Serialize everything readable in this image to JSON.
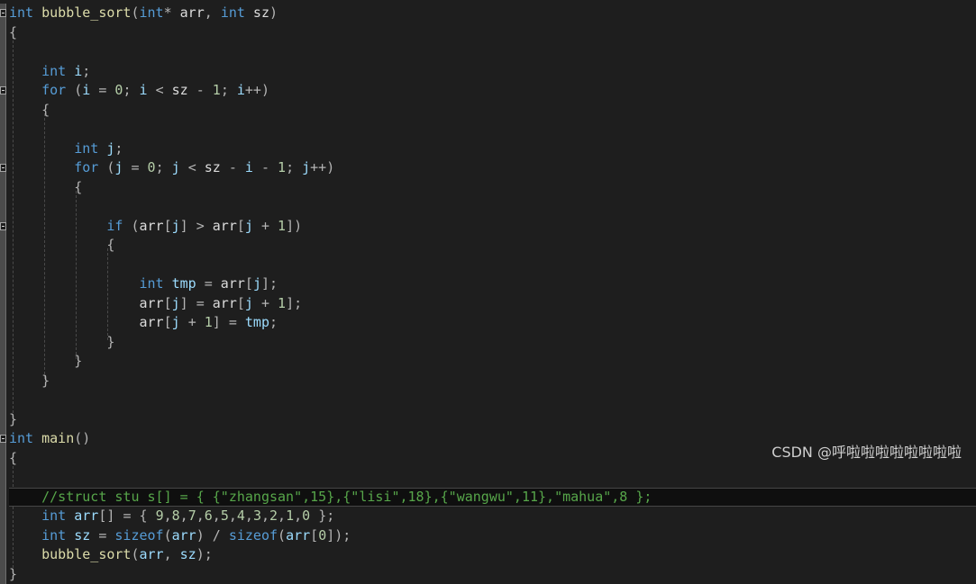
{
  "editor": {
    "lines": [
      [
        [
          "kw",
          "int"
        ],
        [
          "id",
          " "
        ],
        [
          "fn",
          "bubble_sort"
        ],
        [
          "op",
          "("
        ],
        [
          "kw",
          "int"
        ],
        [
          "op",
          "*"
        ],
        [
          "id",
          " arr"
        ],
        [
          "op",
          ","
        ],
        [
          "id",
          " "
        ],
        [
          "kw",
          "int"
        ],
        [
          "id",
          " sz"
        ],
        [
          "op",
          ")"
        ]
      ],
      [
        [
          "op",
          "{"
        ]
      ],
      [
        [
          "id",
          "    "
        ]
      ],
      [
        [
          "id",
          "    "
        ],
        [
          "kw",
          "int"
        ],
        [
          "id",
          " "
        ],
        [
          "var",
          "i"
        ],
        [
          "op",
          ";"
        ]
      ],
      [
        [
          "id",
          "    "
        ],
        [
          "kw",
          "for"
        ],
        [
          "id",
          " "
        ],
        [
          "op",
          "("
        ],
        [
          "var",
          "i"
        ],
        [
          "id",
          " "
        ],
        [
          "op",
          "="
        ],
        [
          "id",
          " "
        ],
        [
          "num",
          "0"
        ],
        [
          "op",
          ";"
        ],
        [
          "id",
          " "
        ],
        [
          "var",
          "i"
        ],
        [
          "id",
          " "
        ],
        [
          "op",
          "<"
        ],
        [
          "id",
          " sz "
        ],
        [
          "op",
          "-"
        ],
        [
          "id",
          " "
        ],
        [
          "num",
          "1"
        ],
        [
          "op",
          ";"
        ],
        [
          "id",
          " "
        ],
        [
          "var",
          "i"
        ],
        [
          "op",
          "++)"
        ]
      ],
      [
        [
          "id",
          "    "
        ],
        [
          "op",
          "{"
        ]
      ],
      [
        [
          "id",
          "        "
        ]
      ],
      [
        [
          "id",
          "        "
        ],
        [
          "kw",
          "int"
        ],
        [
          "id",
          " "
        ],
        [
          "var",
          "j"
        ],
        [
          "op",
          ";"
        ]
      ],
      [
        [
          "id",
          "        "
        ],
        [
          "kw",
          "for"
        ],
        [
          "id",
          " "
        ],
        [
          "op",
          "("
        ],
        [
          "var",
          "j"
        ],
        [
          "id",
          " "
        ],
        [
          "op",
          "="
        ],
        [
          "id",
          " "
        ],
        [
          "num",
          "0"
        ],
        [
          "op",
          ";"
        ],
        [
          "id",
          " "
        ],
        [
          "var",
          "j"
        ],
        [
          "id",
          " "
        ],
        [
          "op",
          "<"
        ],
        [
          "id",
          " sz "
        ],
        [
          "op",
          "-"
        ],
        [
          "id",
          " "
        ],
        [
          "var",
          "i"
        ],
        [
          "id",
          " "
        ],
        [
          "op",
          "-"
        ],
        [
          "id",
          " "
        ],
        [
          "num",
          "1"
        ],
        [
          "op",
          ";"
        ],
        [
          "id",
          " "
        ],
        [
          "var",
          "j"
        ],
        [
          "op",
          "++)"
        ]
      ],
      [
        [
          "id",
          "        "
        ],
        [
          "op",
          "{"
        ]
      ],
      [
        [
          "id",
          "            "
        ]
      ],
      [
        [
          "id",
          "            "
        ],
        [
          "kw",
          "if"
        ],
        [
          "id",
          " "
        ],
        [
          "op",
          "("
        ],
        [
          "id",
          "arr"
        ],
        [
          "op",
          "["
        ],
        [
          "var",
          "j"
        ],
        [
          "op",
          "]"
        ],
        [
          "id",
          " "
        ],
        [
          "op",
          ">"
        ],
        [
          "id",
          " arr"
        ],
        [
          "op",
          "["
        ],
        [
          "var",
          "j"
        ],
        [
          "id",
          " "
        ],
        [
          "op",
          "+"
        ],
        [
          "id",
          " "
        ],
        [
          "num",
          "1"
        ],
        [
          "op",
          "])"
        ]
      ],
      [
        [
          "id",
          "            "
        ],
        [
          "op",
          "{"
        ]
      ],
      [
        [
          "id",
          "                "
        ]
      ],
      [
        [
          "id",
          "                "
        ],
        [
          "kw",
          "int"
        ],
        [
          "id",
          " "
        ],
        [
          "var",
          "tmp"
        ],
        [
          "id",
          " "
        ],
        [
          "op",
          "="
        ],
        [
          "id",
          " arr"
        ],
        [
          "op",
          "["
        ],
        [
          "var",
          "j"
        ],
        [
          "op",
          "];"
        ]
      ],
      [
        [
          "id",
          "                arr"
        ],
        [
          "op",
          "["
        ],
        [
          "var",
          "j"
        ],
        [
          "op",
          "]"
        ],
        [
          "id",
          " "
        ],
        [
          "op",
          "="
        ],
        [
          "id",
          " arr"
        ],
        [
          "op",
          "["
        ],
        [
          "var",
          "j"
        ],
        [
          "id",
          " "
        ],
        [
          "op",
          "+"
        ],
        [
          "id",
          " "
        ],
        [
          "num",
          "1"
        ],
        [
          "op",
          "];"
        ]
      ],
      [
        [
          "id",
          "                arr"
        ],
        [
          "op",
          "["
        ],
        [
          "var",
          "j"
        ],
        [
          "id",
          " "
        ],
        [
          "op",
          "+"
        ],
        [
          "id",
          " "
        ],
        [
          "num",
          "1"
        ],
        [
          "op",
          "]"
        ],
        [
          "id",
          " "
        ],
        [
          "op",
          "="
        ],
        [
          "id",
          " "
        ],
        [
          "var",
          "tmp"
        ],
        [
          "op",
          ";"
        ]
      ],
      [
        [
          "id",
          "            "
        ],
        [
          "op",
          "}"
        ]
      ],
      [
        [
          "id",
          "        "
        ],
        [
          "op",
          "}"
        ]
      ],
      [
        [
          "id",
          "    "
        ],
        [
          "op",
          "}"
        ]
      ],
      [
        [
          "id",
          "    "
        ]
      ],
      [
        [
          "op",
          "}"
        ]
      ],
      [
        [
          "kw",
          "int"
        ],
        [
          "id",
          " "
        ],
        [
          "fn",
          "main"
        ],
        [
          "op",
          "()"
        ]
      ],
      [
        [
          "op",
          "{"
        ]
      ],
      [
        [
          "id",
          "    "
        ]
      ],
      [
        [
          "id",
          "    "
        ],
        [
          "cm",
          "//struct stu s[] = { {\"zhangsan\",15},{\"lisi\",18},{\"wangwu\",11},\"mahua\",8 };"
        ]
      ],
      [
        [
          "id",
          "    "
        ],
        [
          "kw",
          "int"
        ],
        [
          "id",
          " "
        ],
        [
          "var",
          "arr"
        ],
        [
          "op",
          "[]"
        ],
        [
          "id",
          " "
        ],
        [
          "op",
          "="
        ],
        [
          "id",
          " "
        ],
        [
          "op",
          "{"
        ],
        [
          "id",
          " "
        ],
        [
          "num",
          "9"
        ],
        [
          "op",
          ","
        ],
        [
          "num",
          "8"
        ],
        [
          "op",
          ","
        ],
        [
          "num",
          "7"
        ],
        [
          "op",
          ","
        ],
        [
          "num",
          "6"
        ],
        [
          "op",
          ","
        ],
        [
          "num",
          "5"
        ],
        [
          "op",
          ","
        ],
        [
          "num",
          "4"
        ],
        [
          "op",
          ","
        ],
        [
          "num",
          "3"
        ],
        [
          "op",
          ","
        ],
        [
          "num",
          "2"
        ],
        [
          "op",
          ","
        ],
        [
          "num",
          "1"
        ],
        [
          "op",
          ","
        ],
        [
          "num",
          "0"
        ],
        [
          "id",
          " "
        ],
        [
          "op",
          "};"
        ]
      ],
      [
        [
          "id",
          "    "
        ],
        [
          "kw",
          "int"
        ],
        [
          "id",
          " "
        ],
        [
          "var",
          "sz"
        ],
        [
          "id",
          " "
        ],
        [
          "op",
          "="
        ],
        [
          "id",
          " "
        ],
        [
          "kw",
          "sizeof"
        ],
        [
          "op",
          "("
        ],
        [
          "var",
          "arr"
        ],
        [
          "op",
          ")"
        ],
        [
          "id",
          " "
        ],
        [
          "op",
          "/"
        ],
        [
          "id",
          " "
        ],
        [
          "kw",
          "sizeof"
        ],
        [
          "op",
          "("
        ],
        [
          "var",
          "arr"
        ],
        [
          "op",
          "["
        ],
        [
          "num",
          "0"
        ],
        [
          "op",
          "]);"
        ]
      ],
      [
        [
          "id",
          "    "
        ],
        [
          "fn",
          "bubble_sort"
        ],
        [
          "op",
          "("
        ],
        [
          "var",
          "arr"
        ],
        [
          "op",
          ","
        ],
        [
          "id",
          " "
        ],
        [
          "var",
          "sz"
        ],
        [
          "op",
          ");"
        ]
      ],
      [
        [
          "op",
          "}"
        ]
      ]
    ]
  },
  "watermark": "CSDN @呼啦啦啦啦啦啦啦啦"
}
